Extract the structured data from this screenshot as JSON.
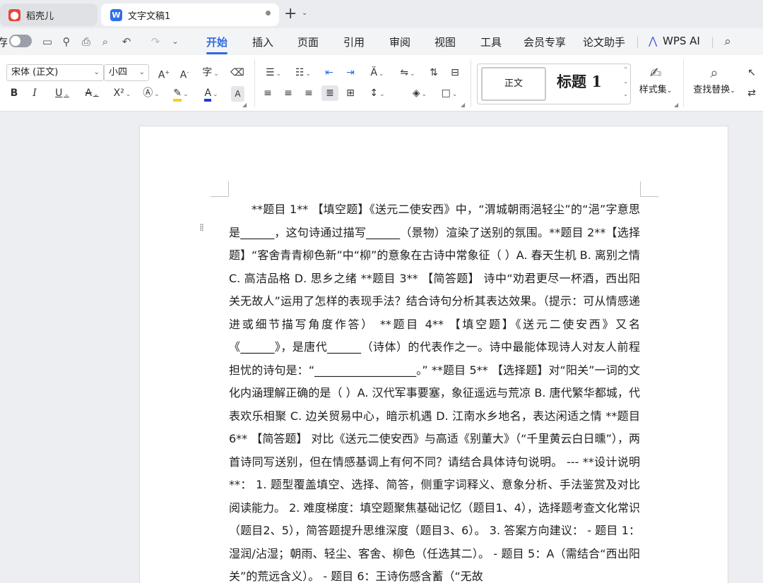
{
  "tabs": [
    {
      "label": "稻壳儿",
      "icon": "daoke-logo-icon"
    },
    {
      "label": "文字文稿1",
      "icon": "wps-writer-icon",
      "modified": true
    }
  ],
  "menu": {
    "quick_access_label": "存",
    "items": [
      "开始",
      "插入",
      "页面",
      "引用",
      "审阅",
      "视图",
      "工具",
      "会员专享",
      "论文助手",
      "WPS AI"
    ],
    "active": "开始"
  },
  "ribbon": {
    "font_name": "宋体 (正文)",
    "font_size": "小四",
    "styles": {
      "normal": "正文",
      "heading1": "标题  1"
    },
    "style_set_label": "样式集",
    "find_replace_label": "查找替换",
    "bold": "B",
    "italic": "I",
    "underline": "U",
    "strike": "A",
    "superscript": "X²",
    "highlight_color": "#f2d21b",
    "font_color": "#1a3fd6"
  },
  "document": {
    "text": "**题目 1** 【填空题】《送元二使安西》中，“渭城朝雨浥轻尘”的“浥”字意思是______，这句诗通过描写______（景物）渲染了送别的氛围。**题目 2**【选择题】“客舍青青柳色新”中“柳”的意象在古诗中常象征（ ）A. 春天生机 B. 离别之情 C. 高洁品格 D. 思乡之绪 **题目 3** 【简答题】 诗中“劝君更尽一杯酒，西出阳关无故人”运用了怎样的表现手法？结合诗句分析其表达效果。（提示：可从情感递进或细节描写角度作答） **题目 4** 【填空题】《送元二使安西》又名《______》，是唐代______（诗体）的代表作之一。诗中最能体现诗人对友人前程担忧的诗句是：“__________________。” **题目 5** 【选择题】对“阳关”一词的文化内涵理解正确的是（ ）A. 汉代军事要塞，象征遥远与荒凉 B. 唐代繁华都城，代表欢乐相聚 C. 边关贸易中心，暗示机遇 D. 江南水乡地名，表达闲适之情 **题目 6** 【简答题】 对比《送元二使安西》与高适《别董大》（“千里黄云白日曛”），两首诗同写送别，但在情感基调上有何不同？请结合具体诗句说明。 --- **设计说明**： 1. 题型覆盖填空、选择、简答，侧重字词释义、意象分析、手法鉴赏及对比阅读能力。 2. 难度梯度：填空题聚焦基础记忆（题目1、4），选择题考查文化常识（题目2、5），简答题提升思维深度（题目3、6）。 3. 答案方向建议： - 题目 1：湿润/沾湿；朝雨、轻尘、客舍、柳色（任选其二）。 - 题目 5：A（需结合“西出阳关”的荒远含义）。 - 题目 6：王诗伤感含蓄（“无故"
  }
}
